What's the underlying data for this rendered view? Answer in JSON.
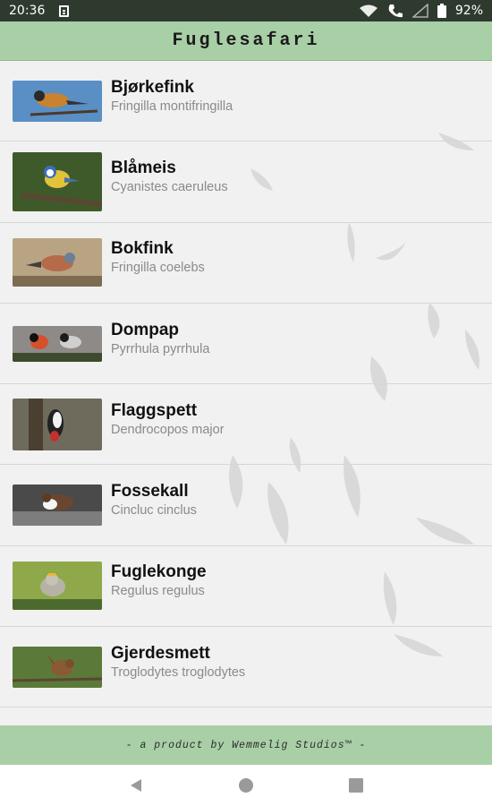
{
  "status": {
    "time": "20:36",
    "battery": "92%",
    "icons": [
      "sim-card-icon",
      "wifi-icon",
      "call-icon",
      "signal-icon",
      "battery-icon"
    ]
  },
  "app": {
    "title": "Fuglesafari"
  },
  "birds": [
    {
      "name": "Bjørkefink",
      "latin": "Fringilla montifringilla",
      "thumb_bg": "#5a8fc6",
      "bird_color": "#c9822e"
    },
    {
      "name": "Blåmeis",
      "latin": "Cyanistes caeruleus",
      "thumb_bg": "#3f5a2a",
      "bird_color": "#e2c33a"
    },
    {
      "name": "Bokfink",
      "latin": "Fringilla coelebs",
      "thumb_bg": "#b8a483",
      "bird_color": "#b56b4a"
    },
    {
      "name": "Dompap",
      "latin": "Pyrrhula pyrrhula",
      "thumb_bg": "#8e8a88",
      "bird_color": "#d5502c"
    },
    {
      "name": "Flaggspett",
      "latin": "Dendrocopos major",
      "thumb_bg": "#6f6b5c",
      "bird_color": "#222222"
    },
    {
      "name": "Fossekall",
      "latin": "Cincluc cinclus",
      "thumb_bg": "#4a4a4a",
      "bird_color": "#6a4630"
    },
    {
      "name": "Fuglekonge",
      "latin": "Regulus regulus",
      "thumb_bg": "#8fa94a",
      "bird_color": "#b7b2a6"
    },
    {
      "name": "Gjerdesmett",
      "latin": "Troglodytes troglodytes",
      "thumb_bg": "#5b7a3a",
      "bird_color": "#8a5a34"
    }
  ],
  "footer": {
    "credit": "- a product by Wemmelig Studios™ -"
  },
  "colors": {
    "app_bar": "#a9cfa7",
    "status_bar": "#2f3a2f",
    "list_bg": "#f1f1f1"
  }
}
